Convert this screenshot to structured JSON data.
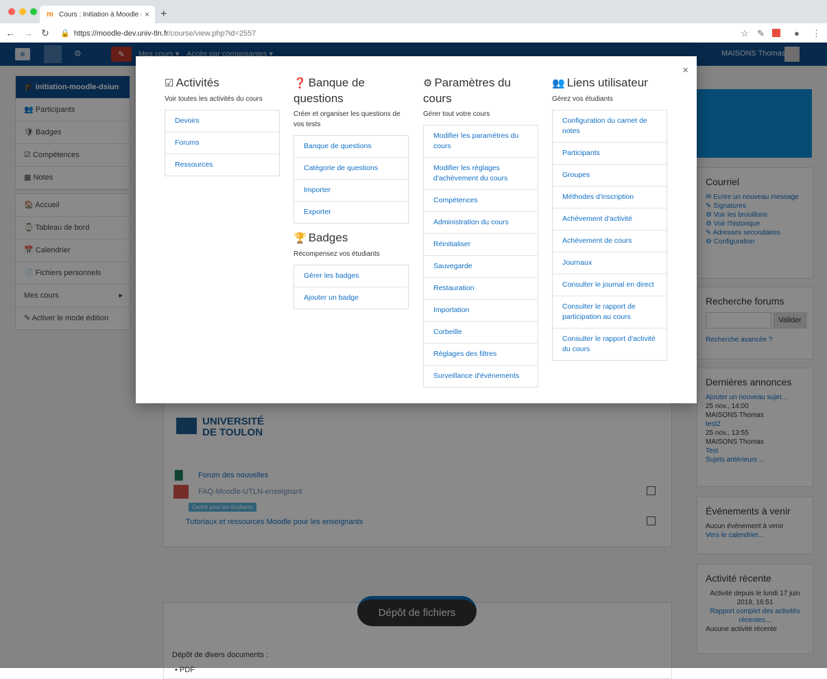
{
  "browser": {
    "tab_title": "Cours : Initiation à Moodle (T...",
    "url_host": "https://moodle-dev.univ-tln.fr",
    "url_path": "/course/view.php?id=2557"
  },
  "navbar": {
    "menu1": "Mes cours",
    "menu2": "Accès par composantes",
    "user": "MAISONS Thomas"
  },
  "left_nav": {
    "course": "initiation-moodle-dsiun",
    "items1": [
      "Participants",
      "Badges",
      "Compétences",
      "Notes"
    ],
    "items2": [
      "Accueil",
      "Tableau de bord",
      "Calendrier",
      "Fichiers personnels",
      "Mes cours",
      "Activer le mode édition"
    ]
  },
  "main": {
    "logo_line1": "UNIVERSITÉ",
    "logo_line2": "DE TOULON",
    "forum": "Forum des nouvelles",
    "faq": "FAQ-Moodle-UTLN-enseignant",
    "hidden_badge": "Caché pour les étudiants",
    "tutoriaux": "Tutoriaux et ressources Moodle pour les enseignants",
    "section_title": "Dépôt de fichiers",
    "section_desc": "Dépôt de divers documents :",
    "section_bullet": "PDF"
  },
  "blocks": {
    "courriel": {
      "title": "Courriel",
      "links": [
        "Ecrire un nouveau message",
        "Signatures",
        "Voir les brouillons",
        "Voir l'historique",
        "Adresses secondaires",
        "Configuration"
      ]
    },
    "recherche": {
      "title": "Recherche forums",
      "button": "Valider",
      "advanced": "Recherche avancée"
    },
    "annonces": {
      "title": "Dernières annonces",
      "add": "Ajouter un nouveau sujet...",
      "p1_date": "25 nov., 14:00",
      "p1_author": "MAISONS Thomas",
      "p1_title": "test2",
      "p2_date": "25 nov., 13:55",
      "p2_author": "MAISONS Thomas",
      "p2_title": "Test",
      "older": "Sujets antérieurs ..."
    },
    "evenements": {
      "title": "Événements à venir",
      "none": "Aucun événement à venir",
      "link": "Vers le calendrier..."
    },
    "activite": {
      "title": "Activité récente",
      "since": "Activité depuis le lundi 17 juin 2019, 16:51",
      "report": "Rapport complet des activités récentes...",
      "none": "Aucune activité récente"
    }
  },
  "modal": {
    "close": "×",
    "activites": {
      "title": "Activités",
      "desc": "Voir toutes les activités du cours",
      "items": [
        "Devoirs",
        "Forums",
        "Ressources"
      ]
    },
    "banque": {
      "title": "Banque de questions",
      "desc": "Créer et organiser les questions de vos tests",
      "items": [
        "Banque de questions",
        "Catégorie de questions",
        "Importer",
        "Exporter"
      ]
    },
    "badges": {
      "title": "Badges",
      "desc": "Récompensez vos étudiants",
      "items": [
        "Gérer les badges",
        "Ajouter un badge"
      ]
    },
    "parametres": {
      "title": "Paramètres du cours",
      "desc": "Gérer tout votre cours",
      "items": [
        "Modifier les paramètres du cours",
        "Modifier les réglages d'achèvement du cours",
        "Compétences",
        "Administration du cours",
        "Réinitialiser",
        "Sauvegarde",
        "Restauration",
        "Importation",
        "Corbeille",
        "Réglages des filtres",
        "Surveillance d'événements"
      ]
    },
    "liens": {
      "title": "Liens utilisateur",
      "desc": "Gérez vos étudiants",
      "items": [
        "Configuration du carnet de notes",
        "Participants",
        "Groupes",
        "Méthodes d'inscription",
        "Achèvement d'activité",
        "Achèvement de cours",
        "Journaux",
        "Consulter le journal en direct",
        "Consulter le rapport de participation au cours",
        "Consulter le rapport d'activité du cours"
      ]
    }
  },
  "colors": {
    "navy": "#0e4d8c",
    "link": "#0f6fc5",
    "edit_red": "#c0392b"
  }
}
